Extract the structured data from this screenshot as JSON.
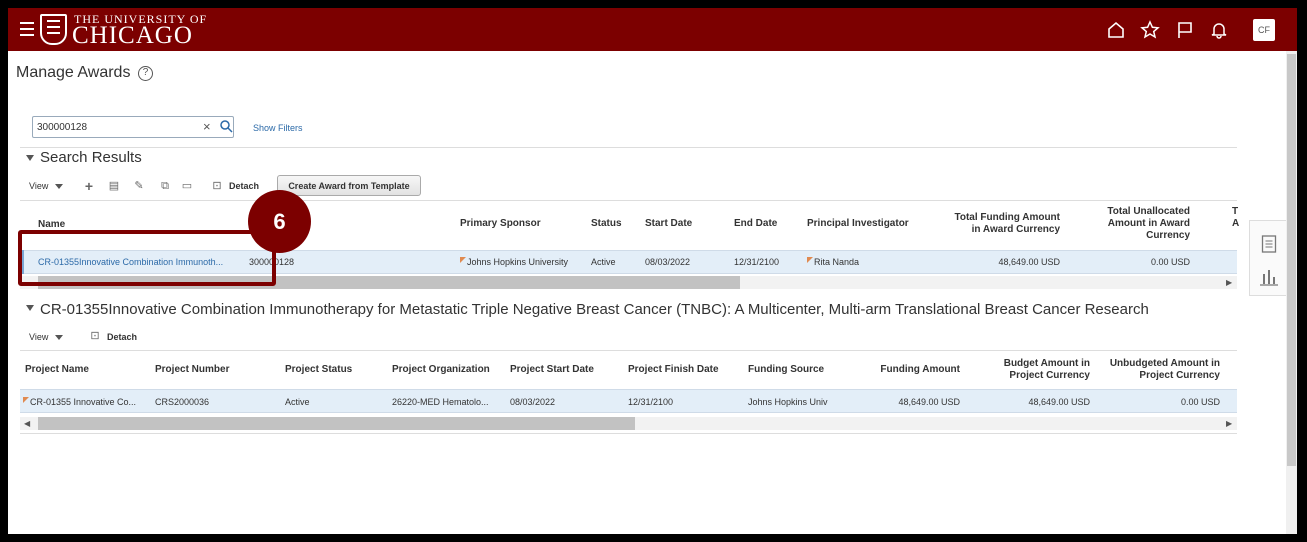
{
  "header": {
    "logo_top": "THE UNIVERSITY OF",
    "logo_main": "CHICAGO",
    "user_initials": "CF"
  },
  "page": {
    "title": "Manage Awards",
    "help_glyph": "?"
  },
  "search": {
    "value": "300000128",
    "show_filters": "Show Filters"
  },
  "results": {
    "title": "Search Results",
    "toolbar": {
      "view": "View",
      "detach": "Detach",
      "create_template": "Create Award from Template"
    },
    "columns": {
      "name": "Name",
      "sponsor": "Primary Sponsor",
      "status": "Status",
      "start": "Start Date",
      "end": "End Date",
      "pi": "Principal Investigator",
      "total_funding_1": "Total Funding Amount",
      "total_funding_2": "in Award Currency",
      "unalloc_1": "Total Unallocated",
      "unalloc_2": "Amount in Award",
      "unalloc_3": "Currency",
      "cut_1": "T",
      "cut_2": "A"
    },
    "row": {
      "name": "CR-01355Innovative Combination Immunoth...",
      "number": "300000128",
      "sponsor": "Johns Hopkins University",
      "status": "Active",
      "start": "08/03/2022",
      "end": "12/31/2100",
      "pi": "Rita Nanda",
      "total_funding": "48,649.00 USD",
      "unallocated": "0.00 USD"
    }
  },
  "detail": {
    "title": "CR-01355Innovative Combination Immunotherapy for Metastatic Triple Negative Breast Cancer (TNBC): A Multicenter, Multi-arm Translational Breast Cancer Research",
    "toolbar": {
      "view": "View",
      "detach": "Detach"
    },
    "columns": {
      "project_name": "Project Name",
      "project_number": "Project Number",
      "project_status": "Project Status",
      "project_org": "Project Organization",
      "project_start": "Project Start Date",
      "project_finish": "Project Finish Date",
      "funding_source": "Funding Source",
      "funding_amount": "Funding Amount",
      "budget_1": "Budget Amount in",
      "budget_2": "Project Currency",
      "unbudgeted_1": "Unbudgeted Amount in",
      "unbudgeted_2": "Project Currency"
    },
    "row": {
      "project_name": "CR-01355 Innovative Co...",
      "project_number": "CRS2000036",
      "project_status": "Active",
      "project_org": "26220-MED Hematolo...",
      "project_start": "08/03/2022",
      "project_finish": "12/31/2100",
      "funding_source": "Johns Hopkins Univ",
      "funding_amount": "48,649.00 USD",
      "budget_amount": "48,649.00 USD",
      "unbudgeted_amount": "0.00 USD"
    }
  },
  "annotation": {
    "step": "6",
    "color": "#7c0000"
  },
  "colors": {
    "brand": "#7c0000",
    "link": "#2c6aa8",
    "row_selected": "#e3eef8"
  }
}
